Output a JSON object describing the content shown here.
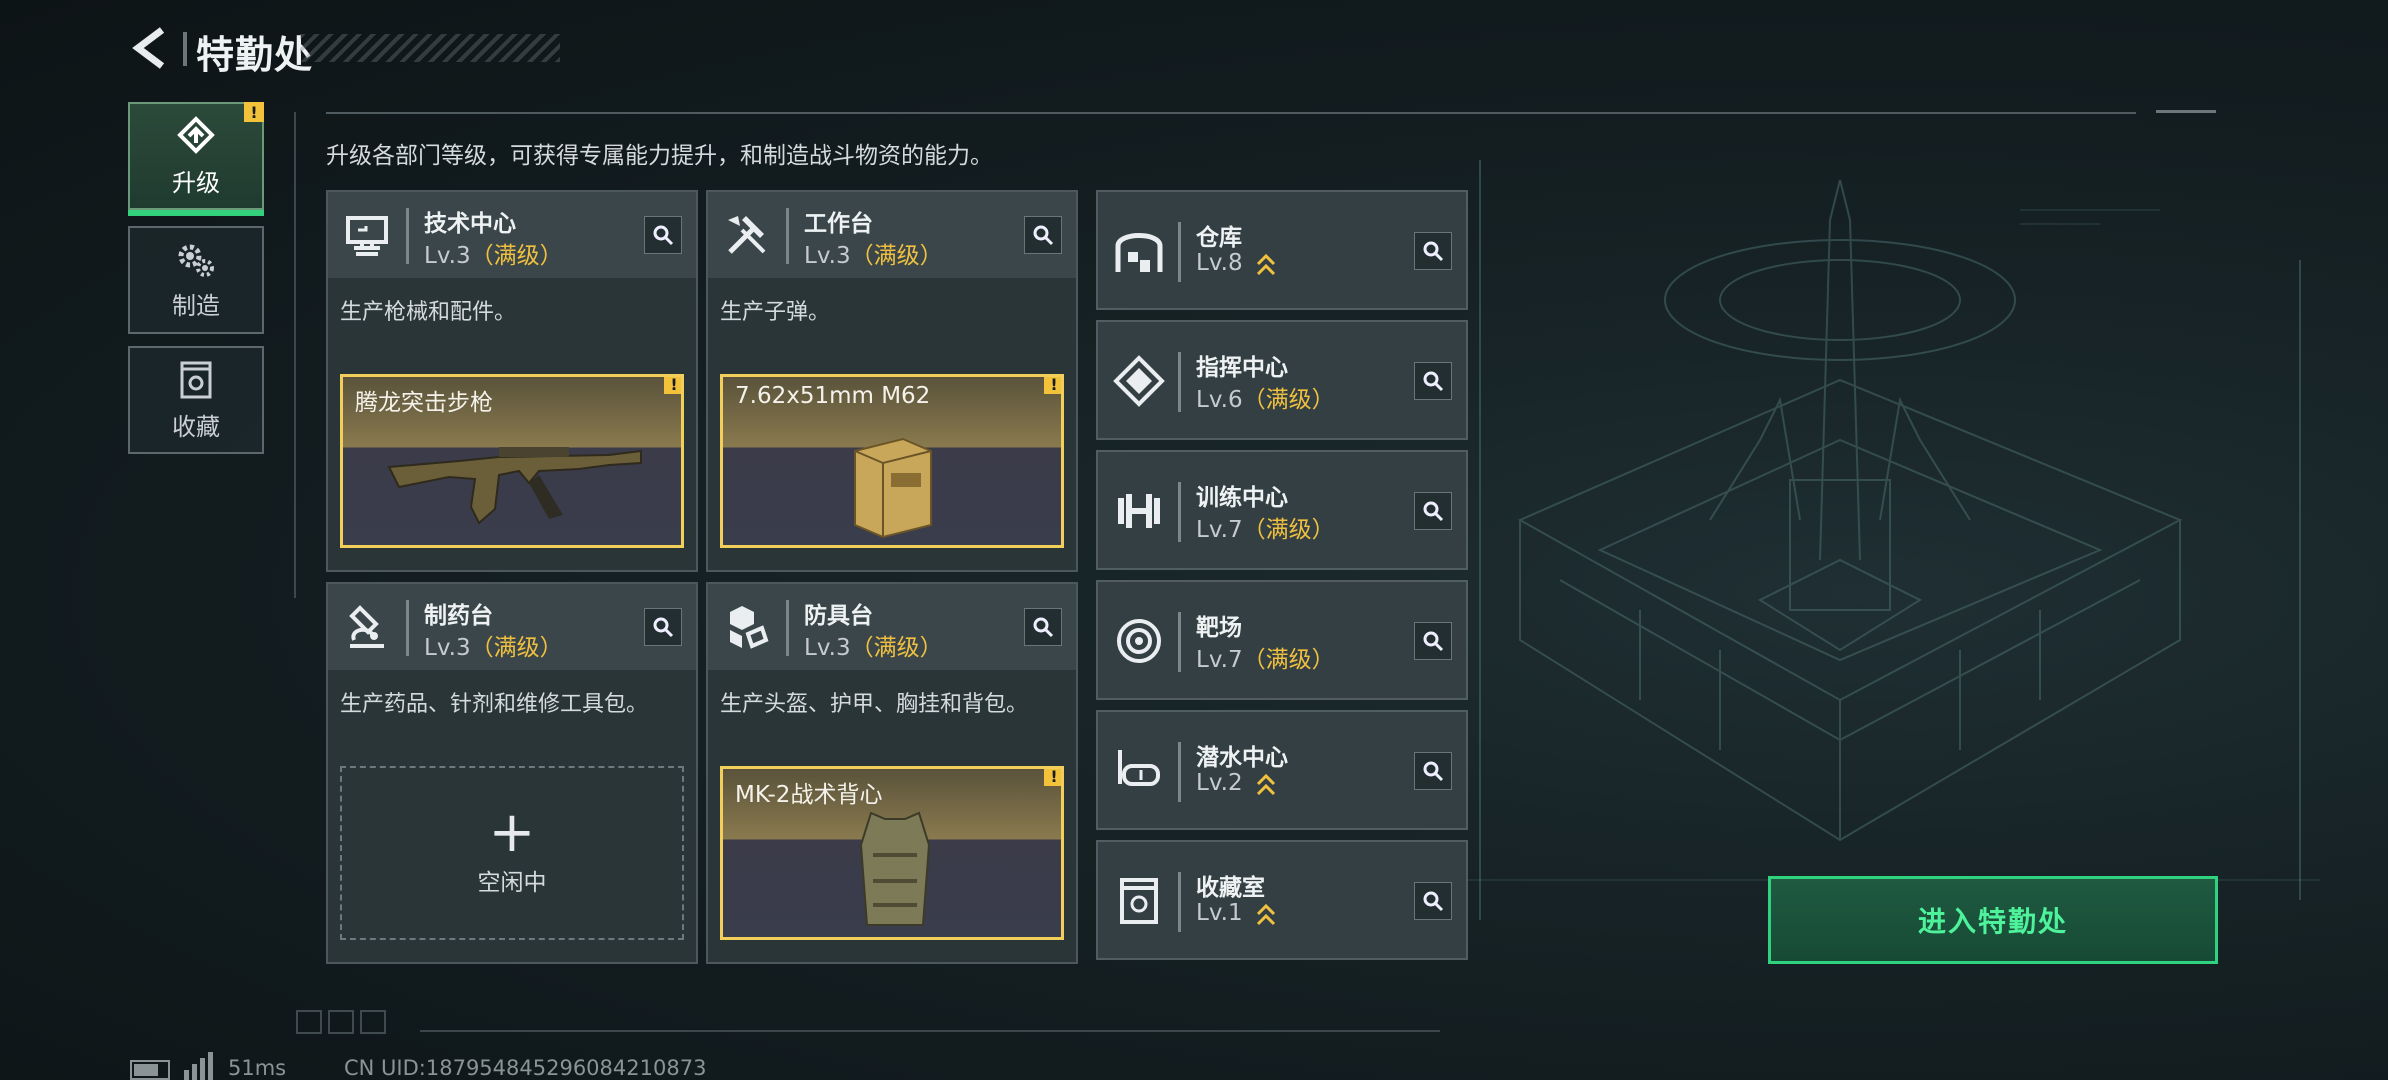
{
  "header": {
    "title": "特勤处"
  },
  "tabs": [
    {
      "label": "升级",
      "icon": "upgrade-icon",
      "active": true,
      "alert": "!"
    },
    {
      "label": "制造",
      "icon": "gears-icon",
      "active": false
    },
    {
      "label": "收藏",
      "icon": "collection-icon",
      "active": false
    }
  ],
  "description": "升级各部门等级，可获得专属能力提升，和制造战斗物资的能力。",
  "production_cards": [
    {
      "name": "技术中心",
      "level": "Lv.3",
      "max": "（满级）",
      "desc": "生产枪械和配件。",
      "slot": {
        "label": "腾龙突击步枪",
        "alert": "!"
      },
      "icon": "tech-center-icon"
    },
    {
      "name": "工作台",
      "level": "Lv.3",
      "max": "（满级）",
      "desc": "生产子弹。",
      "slot": {
        "label": "7.62x51mm M62",
        "alert": "!"
      },
      "icon": "workbench-icon"
    },
    {
      "name": "制药台",
      "level": "Lv.3",
      "max": "（满级）",
      "desc": "生产药品、针剂和维修工具包。",
      "idle": {
        "plus": "+",
        "label": "空闲中"
      },
      "icon": "pharmacy-icon"
    },
    {
      "name": "防具台",
      "level": "Lv.3",
      "max": "（满级）",
      "desc": "生产头盔、护甲、胸挂和背包。",
      "slot": {
        "label": "MK-2战术背心",
        "alert": "!"
      },
      "icon": "armor-bench-icon"
    }
  ],
  "facilities": [
    {
      "name": "仓库",
      "level": "Lv.8",
      "max": "",
      "upgradable": true,
      "icon": "warehouse-icon"
    },
    {
      "name": "指挥中心",
      "level": "Lv.6",
      "max": "（满级）",
      "upgradable": false,
      "icon": "command-center-icon"
    },
    {
      "name": "训练中心",
      "level": "Lv.7",
      "max": "（满级）",
      "upgradable": false,
      "icon": "dumbbell-icon"
    },
    {
      "name": "靶场",
      "level": "Lv.7",
      "max": "（满级）",
      "upgradable": false,
      "icon": "target-icon"
    },
    {
      "name": "潜水中心",
      "level": "Lv.2",
      "max": "",
      "upgradable": true,
      "icon": "diving-mask-icon"
    },
    {
      "name": "收藏室",
      "level": "Lv.1",
      "max": "",
      "upgradable": true,
      "icon": "collection-room-icon"
    }
  ],
  "enter_button": "进入特勤处",
  "footer": {
    "ping": "51ms",
    "uid": "CN UID:1879548452960842108​73"
  },
  "colors": {
    "accent_green": "#34d17c",
    "gold": "#f0c040",
    "panel": "#2a3538"
  }
}
